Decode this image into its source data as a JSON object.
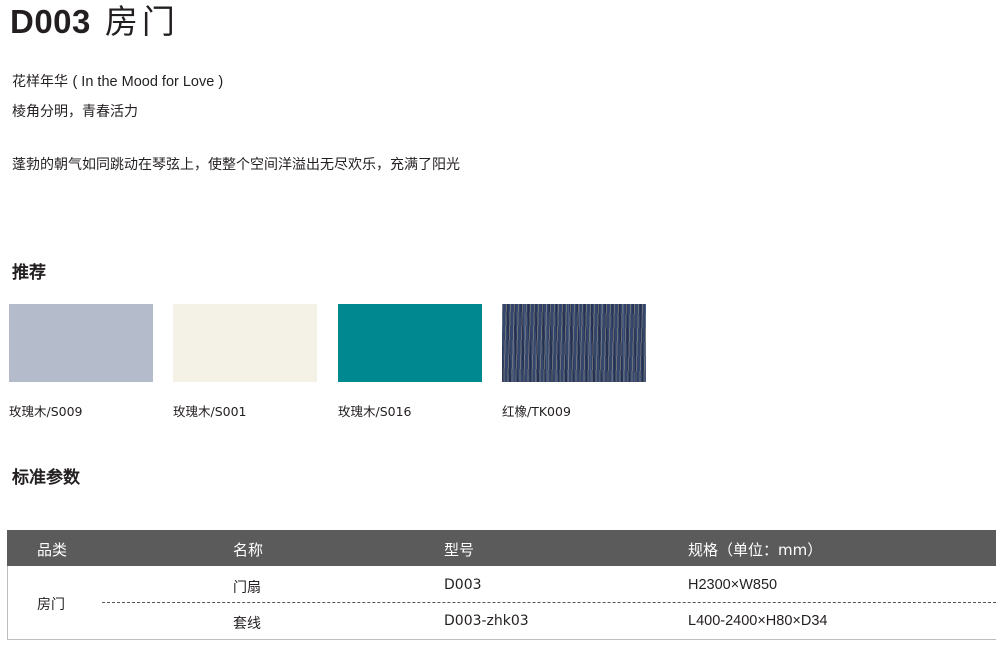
{
  "title": {
    "code": "D003",
    "name": "房门"
  },
  "intro": {
    "line1_cn": "花样年华",
    "line1_en": "( In the Mood for Love )",
    "line2": "棱角分明，青春活力",
    "line3": "蓬勃的朝气如同跳动在琴弦上，使整个空间洋溢出无尽欢乐，充满了阳光"
  },
  "recommend": {
    "heading": "推荐",
    "swatches": [
      {
        "label": "玫瑰木/S009",
        "color": "#b4bccc"
      },
      {
        "label": "玫瑰木/S001",
        "color": "#f4f2e6"
      },
      {
        "label": "玫瑰木/S016",
        "color": "#008890"
      },
      {
        "label": "红橡/TK009",
        "color": "#34466a"
      }
    ]
  },
  "specs": {
    "heading": "标准参数",
    "headers": {
      "category": "品类",
      "name": "名称",
      "model": "型号",
      "spec": "规格（单位：mm）"
    },
    "category": "房门",
    "rows": [
      {
        "name": "门扇",
        "model": "D003",
        "spec": "H2300×W850"
      },
      {
        "name": "套线",
        "model": "D003-zhk03",
        "spec": "L400-2400×H80×D34"
      }
    ],
    "header_bg": "#5c5b5c"
  }
}
